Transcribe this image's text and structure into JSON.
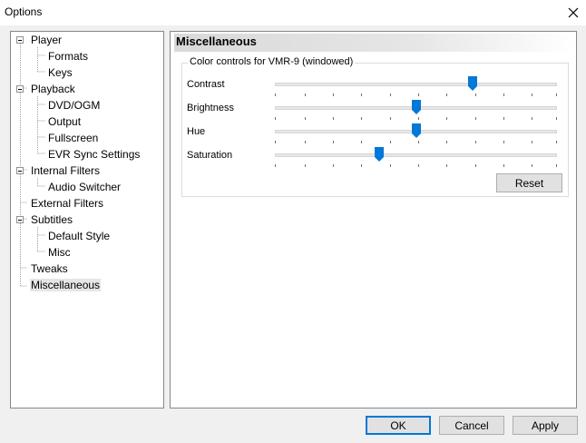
{
  "window": {
    "title": "Options"
  },
  "tree": [
    {
      "label": "Player",
      "expanded": true
    },
    {
      "label": "Formats"
    },
    {
      "label": "Keys"
    },
    {
      "label": "Playback",
      "expanded": true
    },
    {
      "label": "DVD/OGM"
    },
    {
      "label": "Output"
    },
    {
      "label": "Fullscreen"
    },
    {
      "label": "EVR Sync Settings"
    },
    {
      "label": "Internal Filters",
      "expanded": true
    },
    {
      "label": "Audio Switcher"
    },
    {
      "label": "External Filters"
    },
    {
      "label": "Subtitles",
      "expanded": true
    },
    {
      "label": "Default Style"
    },
    {
      "label": "Misc"
    },
    {
      "label": "Tweaks"
    },
    {
      "label": "Miscellaneous",
      "selected": true
    }
  ],
  "panel": {
    "header": "Miscellaneous",
    "group_title": "Color controls for VMR-9 (windowed)",
    "sliders": [
      {
        "label": "Contrast",
        "level": 0.7
      },
      {
        "label": "Brightness",
        "level": 0.5
      },
      {
        "label": "Hue",
        "level": 0.5
      },
      {
        "label": "Saturation",
        "level": 0.37
      }
    ],
    "reset_label": "Reset"
  },
  "buttons": {
    "ok": "OK",
    "cancel": "Cancel",
    "apply": "Apply"
  },
  "colors": {
    "accent": "#0078d7",
    "selection": "#e6e6e6"
  },
  "icons": {
    "close": "close-icon",
    "thumb": "slider-thumb-icon"
  }
}
